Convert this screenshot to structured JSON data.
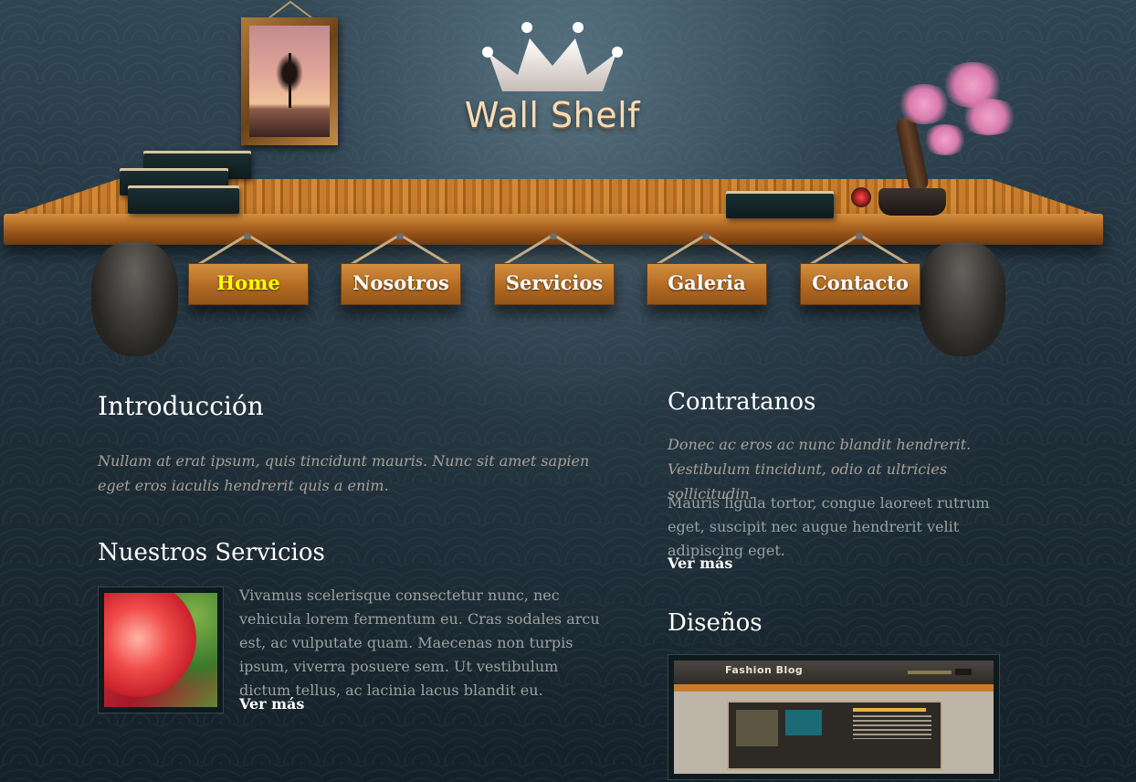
{
  "header": {
    "logo_text": "Wall Shelf"
  },
  "nav": {
    "items": [
      {
        "label": "Home",
        "active": true
      },
      {
        "label": "Nosotros",
        "active": false
      },
      {
        "label": "Servicios",
        "active": false
      },
      {
        "label": "Galeria",
        "active": false
      },
      {
        "label": "Contacto",
        "active": false
      }
    ]
  },
  "main": {
    "intro": {
      "title": "Introducción",
      "text": "Nullam at erat ipsum, quis tincidunt mauris. Nunc sit amet sapien eget eros iaculis hendrerit quis a enim."
    },
    "services": {
      "title": "Nuestros Servicios",
      "text": "Vivamus scelerisque consectetur nunc, nec vehicula lorem fermentum eu. Cras sodales arcu est, ac vulputate quam. Maecenas non turpis ipsum, viverra posuere sem. Ut vestibulum dictum tellus, ac lacinia lacus blandit eu.",
      "more_label": "Ver más"
    }
  },
  "aside": {
    "contact": {
      "title": "Contratanos",
      "italic_text": "Donec ac eros ac nunc blandit hendrerit. Vestibulum tincidunt, odio at ultricies sollicitudin.",
      "text": "Mauris ligula tortor, congue laoreet rutrum eget, suscipit nec augue hendrerit velit adipiscing eget.",
      "more_label": "Ver más"
    },
    "designs": {
      "title": "Diseños",
      "preview_title": "Fashion Blog"
    }
  },
  "colors": {
    "background": "#1d2b35",
    "shelf_wood": "#c67d2d",
    "nav_active_text": "#ffff00",
    "nav_text": "#ffffff",
    "italic_text": "#a6a196",
    "body_text": "#9aa1a3"
  },
  "icons": [
    "crown-logo-icon",
    "framed-tree-picture",
    "bonsai-tree-decoration",
    "book-stack-decoration"
  ]
}
